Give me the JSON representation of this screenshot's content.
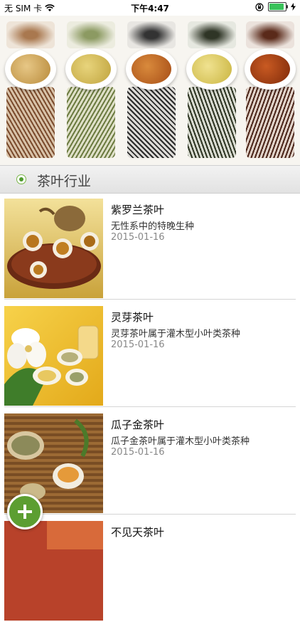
{
  "status_bar": {
    "carrier": "无 SIM 卡",
    "time": "下午4:47"
  },
  "section": {
    "title": "茶叶行业"
  },
  "items": [
    {
      "title": "紫罗兰茶叶",
      "desc": "无性系中的特晚生种",
      "date": "2015-01-16"
    },
    {
      "title": "灵芽茶叶",
      "desc": "灵芽茶叶属于灌木型小叶类茶种",
      "date": "2015-01-16"
    },
    {
      "title": "瓜子金茶叶",
      "desc": "瓜子金茶叶属于灌木型小叶类茶种",
      "date": "2015-01-16"
    },
    {
      "title": "不见天茶叶"
    }
  ],
  "colors": {
    "accent_green": "#5c9e31",
    "section_bg": "#e9e9e9"
  },
  "icons": {
    "fab": "plus-icon",
    "section_marker": "radio-icon"
  }
}
